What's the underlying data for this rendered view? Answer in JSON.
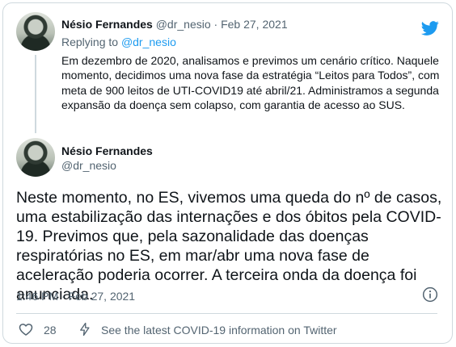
{
  "colors": {
    "accent": "#1d9bf0",
    "text": "#0f1419",
    "muted": "#536471",
    "border": "#cfd9de"
  },
  "icons": [
    "twitter-bird-icon",
    "info-icon",
    "heart-icon",
    "lightning-icon"
  ],
  "parent_tweet": {
    "name": "Nésio Fernandes",
    "handle": "@dr_nesio",
    "separator": "·",
    "date": "Feb 27, 2021",
    "replying_prefix": "Replying to",
    "replying_to": "@dr_nesio",
    "text": "Em dezembro de 2020, analisamos e previmos um cenário crítico. Naquele momento, decidimos uma nova fase da estratégia “Leitos para Todos”, com meta de 900 leitos de UTI-COVID19 até abril/21. Administramos a segunda expansão da doença sem colapso, com garantia de acesso ao SUS."
  },
  "main_tweet": {
    "name": "Nésio Fernandes",
    "handle": "@dr_nesio",
    "text": "Neste momento, no ES, vivemos uma queda do nº de casos, uma estabilização das internações e dos óbitos pela COVID-19. Previmos que, pela sazonalidade das doenças respiratórias no ES, em mar/abr uma nova fase de aceleração poderia ocorrer. A terceira onda da doença foi anunciada.",
    "timestamp": "1:46 PM · Feb 27, 2021"
  },
  "actions": {
    "like_count": "28",
    "covid_link": "See the latest COVID-19 information on Twitter"
  }
}
